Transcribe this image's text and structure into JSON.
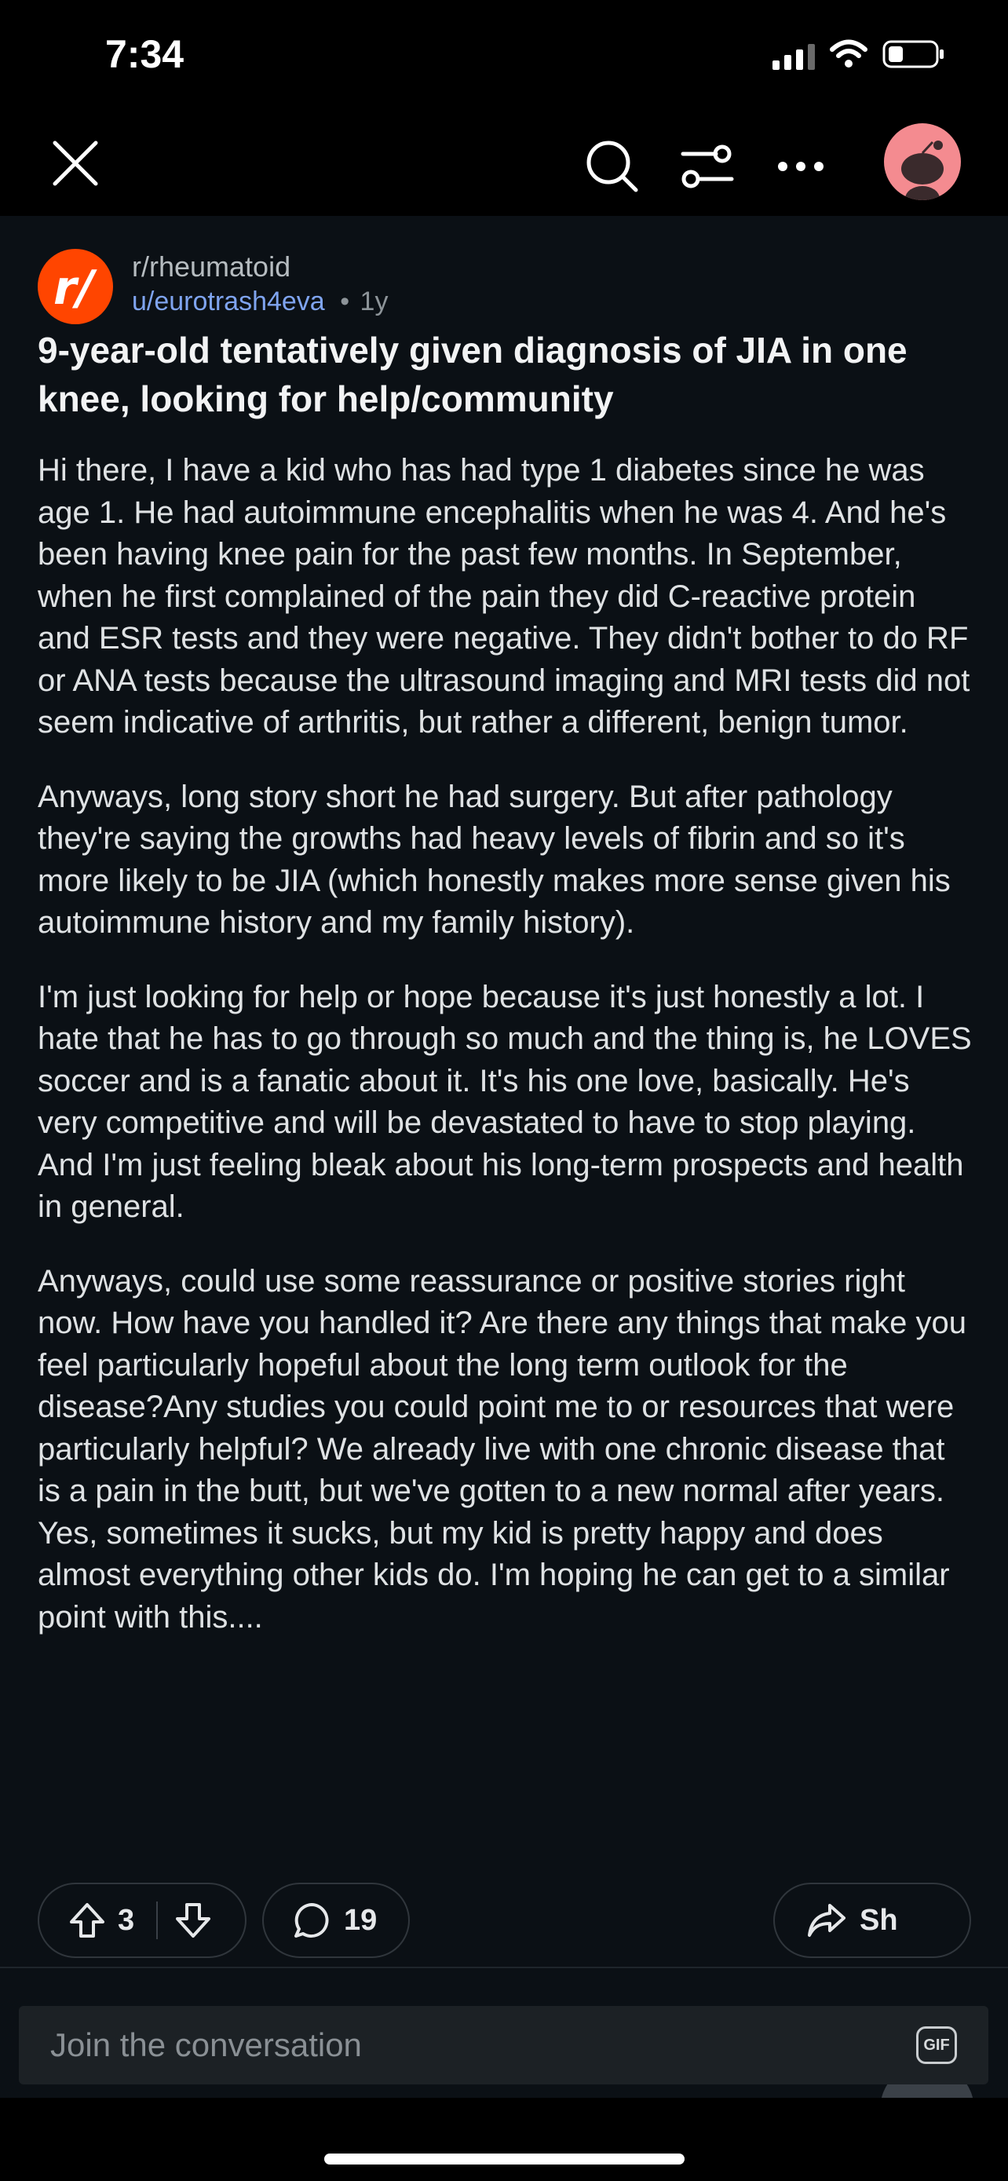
{
  "status_bar": {
    "time": "7:34",
    "icons": [
      "signal-icon",
      "wifi-icon",
      "battery-icon"
    ]
  },
  "toolbar": {
    "icons": [
      "close-icon",
      "search-icon",
      "filter-icon",
      "more-icon",
      "user-avatar"
    ]
  },
  "post": {
    "subreddit": "r/rheumatoid",
    "author": "u/eurotrash4eva",
    "separator": "•",
    "age": "1y",
    "title": "9-year-old tentatively given diagnosis of JIA in one knee, looking for help/community",
    "body": [
      "Hi there, I have a kid who has had type 1 diabetes since he was age 1. He had autoimmune encephalitis when he was 4. And he's been having knee pain for the past few months. In September, when he first complained of the pain they did C-reactive protein and ESR tests and they were negative. They didn't bother to do RF or ANA tests because the ultrasound imaging and MRI tests did not seem indicative of arthritis, but rather a different, benign tumor.",
      "Anyways, long story short he had surgery. But after pathology they're saying the growths had heavy levels of fibrin and so it's more likely to be JIA (which honestly makes more sense given his autoimmune history and my family history).",
      "I'm just looking for help or hope because it's just honestly a lot. I hate that he has to go through so much and the thing is, he LOVES soccer and is a fanatic about it. It's his one love, basically. He's very competitive and will be devastated to have to stop playing. And I'm just feeling bleak about his long-term prospects and health in general.",
      "Anyways, could use some reassurance or positive stories right now.  How have you handled it? Are there any things that make you feel particularly hopeful about the long term outlook for the disease?Any studies you could point me to or resources that were particularly helpful? We already live with one chronic disease that is a pain in the butt, but we've gotten to a new normal after years. Yes, sometimes it sucks, but my kid is pretty happy and does almost everything other kids do. I'm hoping he can get to a similar point with this...."
    ],
    "upvotes": "3",
    "comments": "19",
    "share_label_visible": "Sh"
  },
  "composer": {
    "placeholder": "Join the conversation",
    "gif_label": "GIF"
  },
  "colors": {
    "background": "#0b1015",
    "subreddit_icon": "#ff4500",
    "author_link": "#7fa4ef",
    "avatar_bg": "#f48b90"
  }
}
